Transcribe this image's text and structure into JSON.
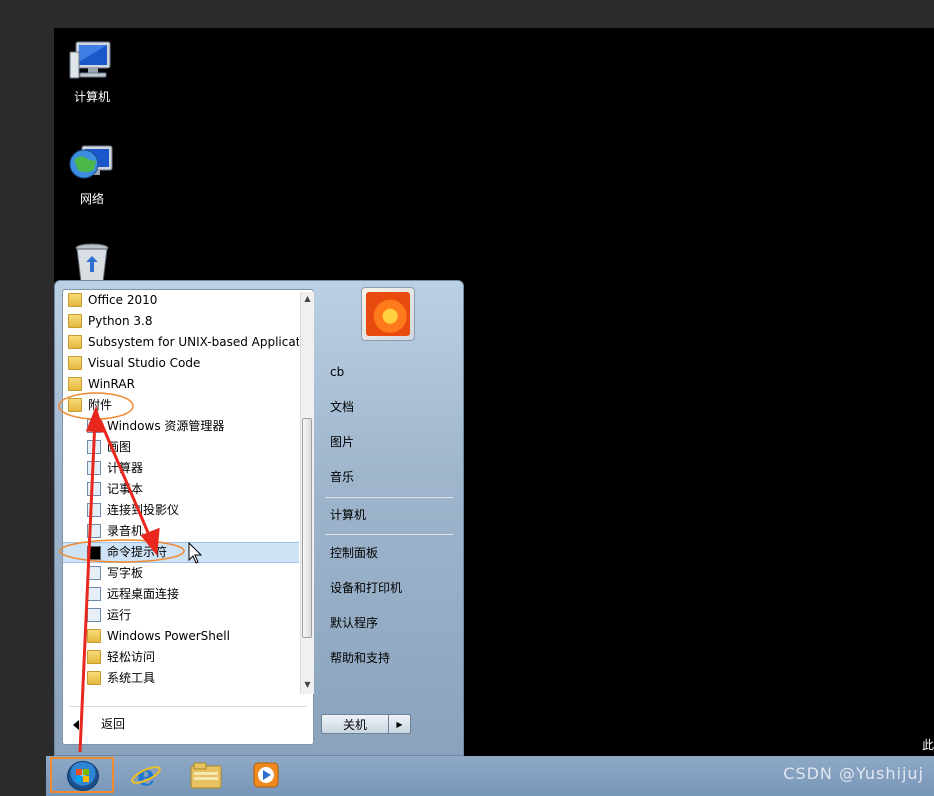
{
  "desktop": {
    "icons": [
      {
        "label": "计算机",
        "icon": "computer-icon"
      },
      {
        "label": "网络",
        "icon": "network-icon"
      },
      {
        "label": "",
        "icon": "recycle-bin-icon"
      }
    ],
    "edge_text": "此"
  },
  "start_menu": {
    "programs": [
      {
        "label": "Office 2010",
        "icon": "folder-icon",
        "level": 0
      },
      {
        "label": "Python 3.8",
        "icon": "folder-icon",
        "level": 0
      },
      {
        "label": "Subsystem for UNIX-based Applicat",
        "icon": "folder-icon",
        "level": 0
      },
      {
        "label": "Visual Studio Code",
        "icon": "folder-icon",
        "level": 0
      },
      {
        "label": "WinRAR",
        "icon": "folder-icon",
        "level": 0
      },
      {
        "label": "附件",
        "icon": "folder-open-icon",
        "level": 0
      },
      {
        "label": "Windows 资源管理器",
        "icon": "explorer-icon",
        "level": 1
      },
      {
        "label": "画图",
        "icon": "paint-icon",
        "level": 1
      },
      {
        "label": "计算器",
        "icon": "calculator-icon",
        "level": 1
      },
      {
        "label": "记事本",
        "icon": "notepad-icon",
        "level": 1
      },
      {
        "label": "连接到投影仪",
        "icon": "projector-icon",
        "level": 1
      },
      {
        "label": "录音机",
        "icon": "recorder-icon",
        "level": 1
      },
      {
        "label": "命令提示符",
        "icon": "cmd-icon",
        "level": 1
      },
      {
        "label": "写字板",
        "icon": "wordpad-icon",
        "level": 1
      },
      {
        "label": "远程桌面连接",
        "icon": "remote-desktop-icon",
        "level": 1
      },
      {
        "label": "运行",
        "icon": "run-icon",
        "level": 1
      },
      {
        "label": "Windows PowerShell",
        "icon": "folder-icon",
        "level": 1
      },
      {
        "label": "轻松访问",
        "icon": "folder-icon",
        "level": 1
      },
      {
        "label": "系统工具",
        "icon": "folder-icon",
        "level": 1
      }
    ],
    "highlighted_index": 12,
    "back_label": "返回",
    "user_name": "cb",
    "right_items_group1": [
      "文档",
      "图片",
      "音乐"
    ],
    "right_items_group2": [
      "计算机"
    ],
    "right_items_group3": [
      "控制面板",
      "设备和打印机",
      "默认程序",
      "帮助和支持"
    ],
    "shutdown_label": "关机",
    "scroll_up_glyph": "▲",
    "scroll_down_glyph": "▼",
    "shutdown_arrow_glyph": "▶"
  },
  "taskbar": {
    "pinned": [
      "internet-explorer-icon",
      "file-explorer-icon",
      "media-player-icon"
    ]
  },
  "watermark": "CSDN @Yushijuj",
  "colors": {
    "annotation_red": "#e8281e",
    "annotation_orange": "#f08a30",
    "highlight": "#cfe3f7"
  }
}
